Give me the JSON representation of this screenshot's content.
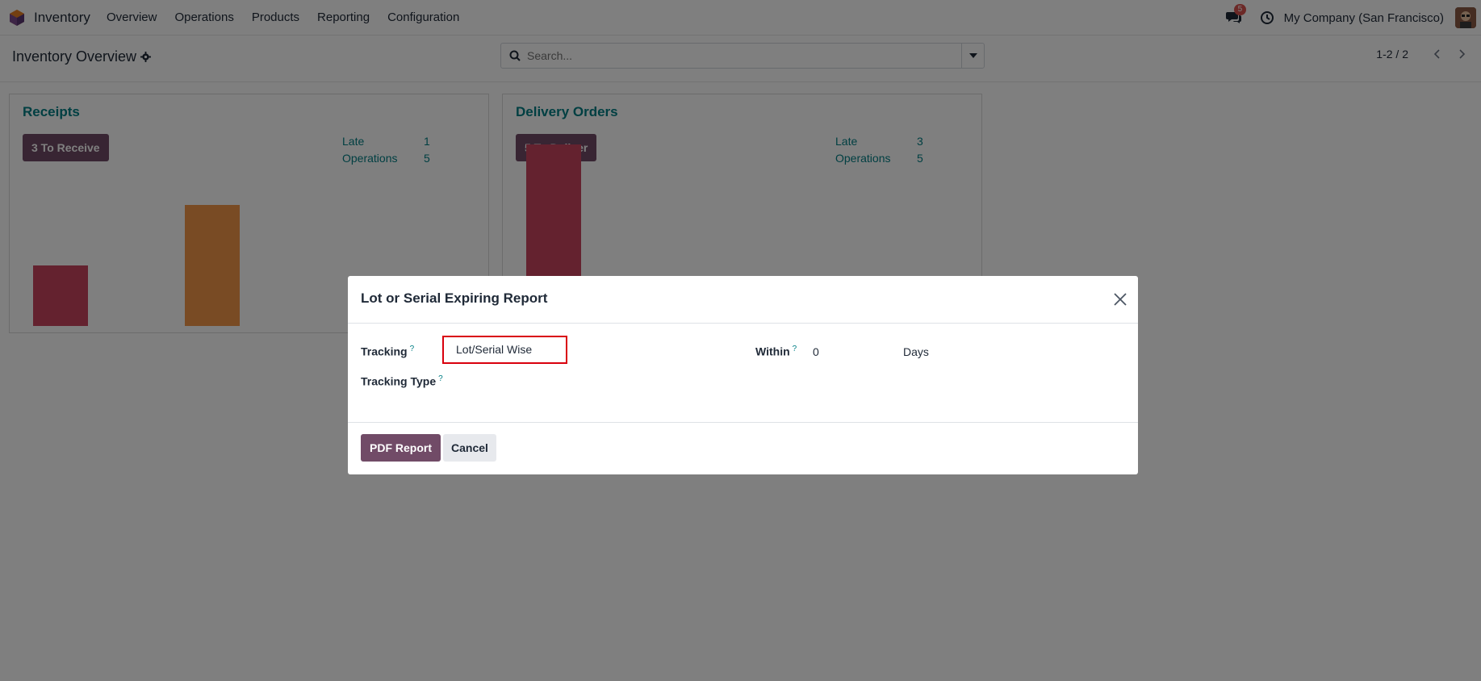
{
  "navbar": {
    "app_name": "Inventory",
    "menu": [
      "Overview",
      "Operations",
      "Products",
      "Reporting",
      "Configuration"
    ],
    "chat_badge": "5",
    "company": "My Company (San Francisco)"
  },
  "control_panel": {
    "title": "Inventory Overview",
    "search_placeholder": "Search...",
    "pager": "1-2 / 2"
  },
  "cards": [
    {
      "title": "Receipts",
      "button": "3 To Receive",
      "stats": [
        {
          "label": "Late",
          "value": "1"
        },
        {
          "label": "Operations",
          "value": "5"
        }
      ],
      "bar_values": [
        1,
        2
      ],
      "bar_colors": [
        "#c9445e",
        "#f29648"
      ]
    },
    {
      "title": "Delivery Orders",
      "button": "5 To Deliver",
      "stats": [
        {
          "label": "Late",
          "value": "3"
        },
        {
          "label": "Operations",
          "value": "5"
        }
      ],
      "bar_values": [
        3
      ],
      "bar_colors": [
        "#c9445e"
      ]
    }
  ],
  "modal": {
    "title": "Lot or Serial Expiring Report",
    "tracking_label": "Tracking",
    "tracking_value": "Lot/Serial Wise",
    "tracking_type_label": "Tracking Type",
    "within_label": "Within",
    "within_value": "0",
    "within_unit": "Days",
    "help_mark": "?",
    "pdf_button": "PDF Report",
    "cancel_button": "Cancel"
  },
  "colors": {
    "brand": "#714b67",
    "accent": "#017e84",
    "highlight": "#d9000d"
  }
}
